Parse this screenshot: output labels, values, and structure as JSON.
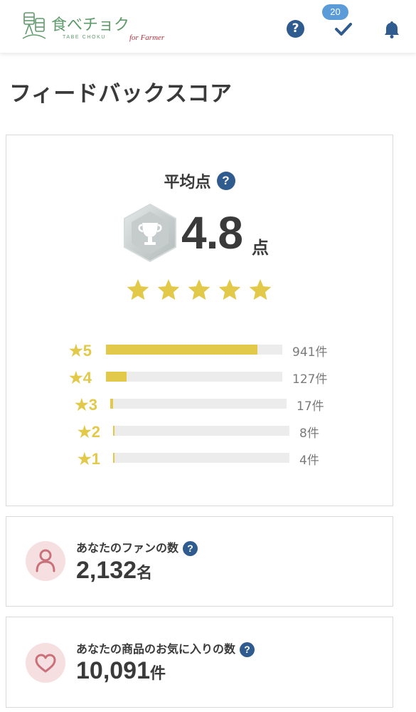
{
  "header": {
    "logo_main": "食べチョク",
    "logo_sub": "TABE CHOKU",
    "logo_tag": "for Farmer",
    "help_icon": "question-circle-icon",
    "check_icon": "check-icon",
    "bell_icon": "bell-icon",
    "badge_count": "20"
  },
  "page": {
    "title": "フィードバックスコア"
  },
  "average": {
    "label": "平均点",
    "help_icon": "question-circle-icon",
    "score": "4.8",
    "unit": "点",
    "trophy_icon": "trophy-icon",
    "stars": 5
  },
  "distribution": [
    {
      "label": "★5",
      "count": "941件",
      "value": 941
    },
    {
      "label": "★4",
      "count": "127件",
      "value": 127
    },
    {
      "label": "★3",
      "count": "17件",
      "value": 17
    },
    {
      "label": "★2",
      "count": "8件",
      "value": 8
    },
    {
      "label": "★1",
      "count": "4件",
      "value": 4
    }
  ],
  "fans": {
    "label": "あなたのファンの数",
    "value": "2,132",
    "unit": "名",
    "icon": "person-icon"
  },
  "favorites": {
    "label": "あなたの商品のお気に入りの数",
    "value": "10,091",
    "unit": "件",
    "icon": "heart-icon"
  },
  "colors": {
    "accent_yellow": "#e2c94a",
    "help_blue": "#2f5b8e",
    "badge_blue": "#5a9bd8",
    "logo_green": "#5e9b6a",
    "logo_red": "#b6323d",
    "icon_pink_bg": "#f6dfe1",
    "icon_pink": "#c9717a"
  }
}
